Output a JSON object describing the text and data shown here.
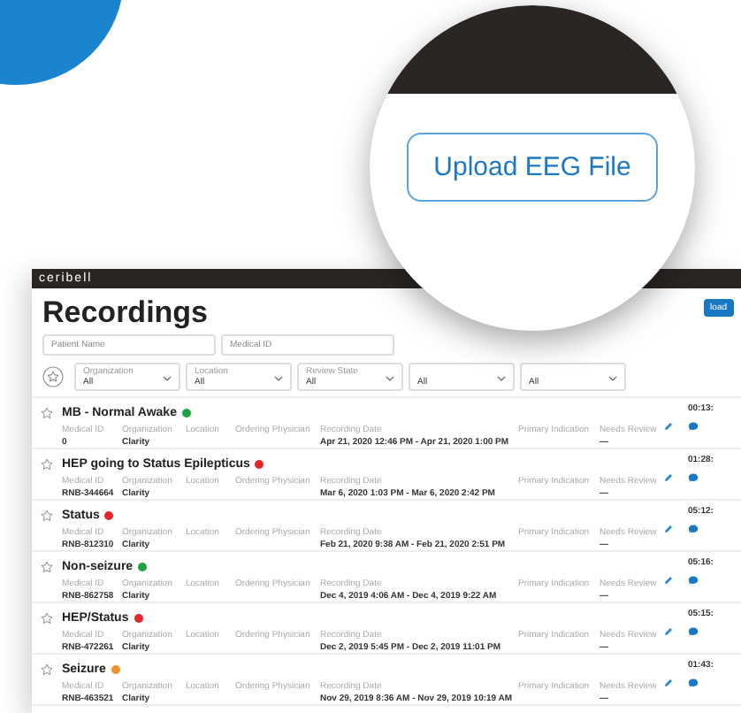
{
  "app": {
    "logo": "ceribell",
    "page_title": "Recordings",
    "header_button": "load"
  },
  "search": [
    {
      "placeholder": "Patient Name"
    },
    {
      "placeholder": "Medical ID"
    }
  ],
  "filters": [
    {
      "label": "Organization",
      "value": "All"
    },
    {
      "label": "Location",
      "value": "All"
    },
    {
      "label": "Review State",
      "value": "All"
    },
    {
      "value": "All"
    },
    {
      "value": "All"
    }
  ],
  "recordings": [
    {
      "title": "MB - Normal Awake",
      "color": "#1ea340",
      "duration": "00:13:",
      "fields": [
        {
          "label": "Medical ID",
          "value": "0"
        },
        {
          "label": "Organization",
          "value": "Clarity"
        },
        {
          "label": "Location"
        },
        {
          "label": "Ordering Physician"
        },
        {
          "label": "Recording Date",
          "value": "Apr 21, 2020 12:46 PM - Apr 21, 2020 1:00 PM"
        },
        {
          "label": "Primary Indication"
        },
        {
          "label": "Needs Review",
          "value": "—"
        }
      ]
    },
    {
      "title": "HEP going to Status Epilepticus",
      "color": "#e3262b",
      "duration": "01:28:",
      "fields": [
        {
          "label": "Medical ID",
          "value": "RNB-344664"
        },
        {
          "label": "Organization",
          "value": "Clarity"
        },
        {
          "label": "Location"
        },
        {
          "label": "Ordering Physician"
        },
        {
          "label": "Recording Date",
          "value": "Mar 6, 2020 1:03 PM - Mar 6, 2020 2:42 PM"
        },
        {
          "label": "Primary Indication"
        },
        {
          "label": "Needs Review",
          "value": "—"
        }
      ]
    },
    {
      "title": "Status",
      "color": "#e3262b",
      "duration": "05:12:",
      "fields": [
        {
          "label": "Medical ID",
          "value": "RNB-812310"
        },
        {
          "label": "Organization",
          "value": "Clarity"
        },
        {
          "label": "Location"
        },
        {
          "label": "Ordering Physician"
        },
        {
          "label": "Recording Date",
          "value": "Feb 21, 2020 9:38 AM - Feb 21, 2020 2:51 PM"
        },
        {
          "label": "Primary Indication"
        },
        {
          "label": "Needs Review",
          "value": "—"
        }
      ]
    },
    {
      "title": "Non-seizure",
      "color": "#1ea340",
      "duration": "05:16:",
      "fields": [
        {
          "label": "Medical ID",
          "value": "RNB-862758"
        },
        {
          "label": "Organization",
          "value": "Clarity"
        },
        {
          "label": "Location"
        },
        {
          "label": "Ordering Physician"
        },
        {
          "label": "Recording Date",
          "value": "Dec 4, 2019 4:06 AM - Dec 4, 2019 9:22 AM"
        },
        {
          "label": "Primary Indication"
        },
        {
          "label": "Needs Review",
          "value": "—"
        }
      ]
    },
    {
      "title": "HEP/Status",
      "color": "#e3262b",
      "duration": "05:15:",
      "fields": [
        {
          "label": "Medical ID",
          "value": "RNB-472261"
        },
        {
          "label": "Organization",
          "value": "Clarity"
        },
        {
          "label": "Location"
        },
        {
          "label": "Ordering Physician"
        },
        {
          "label": "Recording Date",
          "value": "Dec 2, 2019 5:45 PM - Dec 2, 2019 11:01 PM"
        },
        {
          "label": "Primary Indication"
        },
        {
          "label": "Needs Review",
          "value": "—"
        }
      ]
    },
    {
      "title": "Seizure",
      "color": "#f0922a",
      "duration": "01:43:",
      "fields": [
        {
          "label": "Medical ID",
          "value": "RNB-463521"
        },
        {
          "label": "Organization",
          "value": "Clarity"
        },
        {
          "label": "Location"
        },
        {
          "label": "Ordering Physician"
        },
        {
          "label": "Recording Date",
          "value": "Nov 29, 2019 8:36 AM - Nov 29, 2019 10:19 AM"
        },
        {
          "label": "Primary Indication"
        },
        {
          "label": "Needs Review",
          "value": "—"
        }
      ]
    }
  ],
  "magnifier": {
    "button": "Upload EEG File"
  }
}
